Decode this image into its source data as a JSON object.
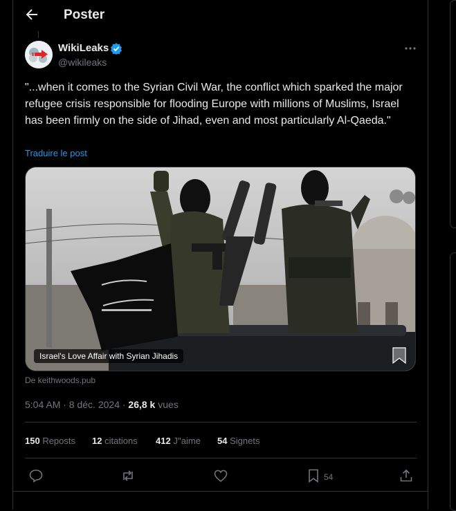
{
  "header": {
    "title": "Poster"
  },
  "post": {
    "author_name": "WikiLeaks",
    "author_handle": "@wikileaks",
    "text": "\"...when it comes to the Syrian Civil War, the conflict which sparked the major refugee crisis responsible for flooding Europe with millions of Muslims, Israel has been firmly on the side of Jihad, even and most particularly Al-Qaeda.\"",
    "translate_label": "Traduire le post",
    "media_caption": "Israel's Love Affair with Syrian Jihadis",
    "source": "De keithwoods.pub",
    "timestamp": "5:04 AM · 8 déc. 2024 · ",
    "views_count": "26,8 k",
    "views_label": " vues"
  },
  "stats": {
    "reposts_count": "150",
    "reposts_label": " Reposts",
    "quotes_count": "12",
    "quotes_label": " citations",
    "likes_count": "412",
    "likes_label": " J''aime",
    "bookmarks_count": "54",
    "bookmarks_label": " Signets"
  },
  "actions": {
    "bookmark_count": "54"
  },
  "colors": {
    "accent": "#1d9bf0",
    "background": "#000000",
    "text": "#e7e9ea",
    "muted": "#71767b",
    "border": "#2f3336"
  },
  "icons": [
    "back-arrow-icon",
    "verified-badge-icon",
    "more-options-icon",
    "reply-icon",
    "repost-icon",
    "like-icon",
    "bookmark-icon",
    "share-icon"
  ]
}
